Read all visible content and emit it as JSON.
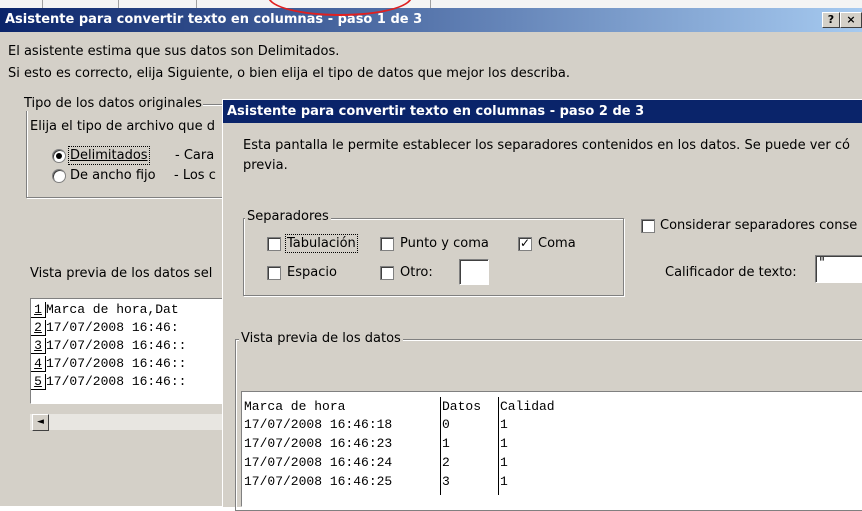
{
  "dialog1": {
    "title": "Asistente para convertir texto en columnas - paso 1 de 3",
    "help_btn": "?",
    "close_btn": "×",
    "intro_line1": "El asistente estima que sus datos son Delimitados.",
    "intro_line2": "Si esto es correcto, elija Siguiente, o bien elija el tipo de datos que mejor los describa.",
    "group_title": "Tipo de los datos originales",
    "group_prompt": "Elija el tipo de archivo que d",
    "options": [
      {
        "label": "Delimitados",
        "desc": "- Cara",
        "selected": true
      },
      {
        "label": "De ancho fijo",
        "desc": "- Los c",
        "selected": false
      }
    ],
    "preview_label": "Vista previa de los datos sel",
    "preview_rows": [
      {
        "n": "1",
        "text": "Marca de hora,Dat"
      },
      {
        "n": "2",
        "text": "17/07/2008 16:46:"
      },
      {
        "n": "3",
        "text": "17/07/2008 16:46::"
      },
      {
        "n": "4",
        "text": "17/07/2008 16:46::"
      },
      {
        "n": "5",
        "text": "17/07/2008 16:46::"
      }
    ]
  },
  "dialog2": {
    "title": "Asistente para convertir texto en columnas - paso 2 de 3",
    "desc_line1": "Esta pantalla le permite establecer los separadores contenidos en los datos. Se puede ver có",
    "desc_line2": "previa.",
    "separators_title": "Separadores",
    "separators": [
      {
        "label": "Tabulación",
        "checked": false
      },
      {
        "label": "Punto y coma",
        "checked": false
      },
      {
        "label": "Coma",
        "checked": true
      },
      {
        "label": "Espacio",
        "checked": false
      },
      {
        "label": "Otro:",
        "checked": false
      }
    ],
    "otro_value": "",
    "consecutive_label": "Considerar separadores conse",
    "consecutive_checked": false,
    "qualifier_label": "Calificador de texto:",
    "qualifier_value": "\"",
    "preview_title": "Vista previa de los datos",
    "preview_columns": [
      "Marca de hora",
      "Datos",
      "Calidad"
    ],
    "preview_rows": [
      [
        "17/07/2008 16:46:18",
        "0",
        "1"
      ],
      [
        "17/07/2008 16:46:23",
        "1",
        "1"
      ],
      [
        "17/07/2008 16:46:24",
        "2",
        "1"
      ],
      [
        "17/07/2008 16:46:25",
        "3",
        "1"
      ]
    ]
  },
  "colors": {
    "title_active": "#0a246a",
    "title_gradient_end": "#a6caf0",
    "face": "#d4d0c8",
    "highlight_circle": "#e02020"
  }
}
